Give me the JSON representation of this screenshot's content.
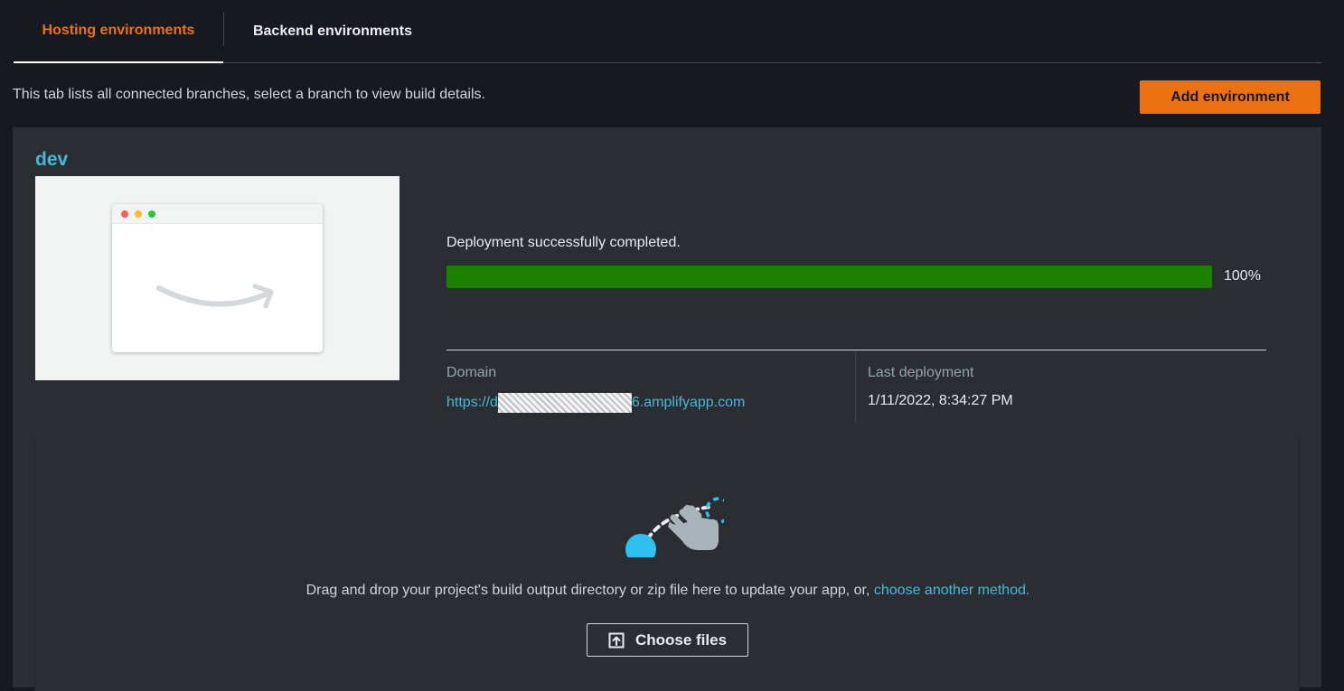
{
  "tabs": {
    "hosting": "Hosting environments",
    "backend": "Backend environments"
  },
  "description": "This tab lists all connected branches, select a branch to view build details.",
  "add_environment_label": "Add environment",
  "branch": {
    "name": "dev",
    "status": "Deployment successfully completed.",
    "progress_percent": 100,
    "progress_label": "100%",
    "domain_label": "Domain",
    "domain_prefix": "https://d",
    "domain_suffix": "6.amplifyapp.com",
    "last_deployment_label": "Last deployment",
    "last_deployment_value": "1/11/2022, 8:34:27 PM"
  },
  "dropzone": {
    "text": "Drag and drop your project's build output directory or zip file here to update your app, or, ",
    "link": "choose another method.",
    "choose_files_label": "Choose files"
  },
  "colors": {
    "accent": "#ec7211",
    "link": "#44b9d6",
    "success": "#1d8102",
    "background": "#16191f",
    "card": "#2a2e33"
  },
  "icons": [
    "amazon-smile-icon",
    "drag-drop-hand-icon",
    "upload-icon"
  ]
}
